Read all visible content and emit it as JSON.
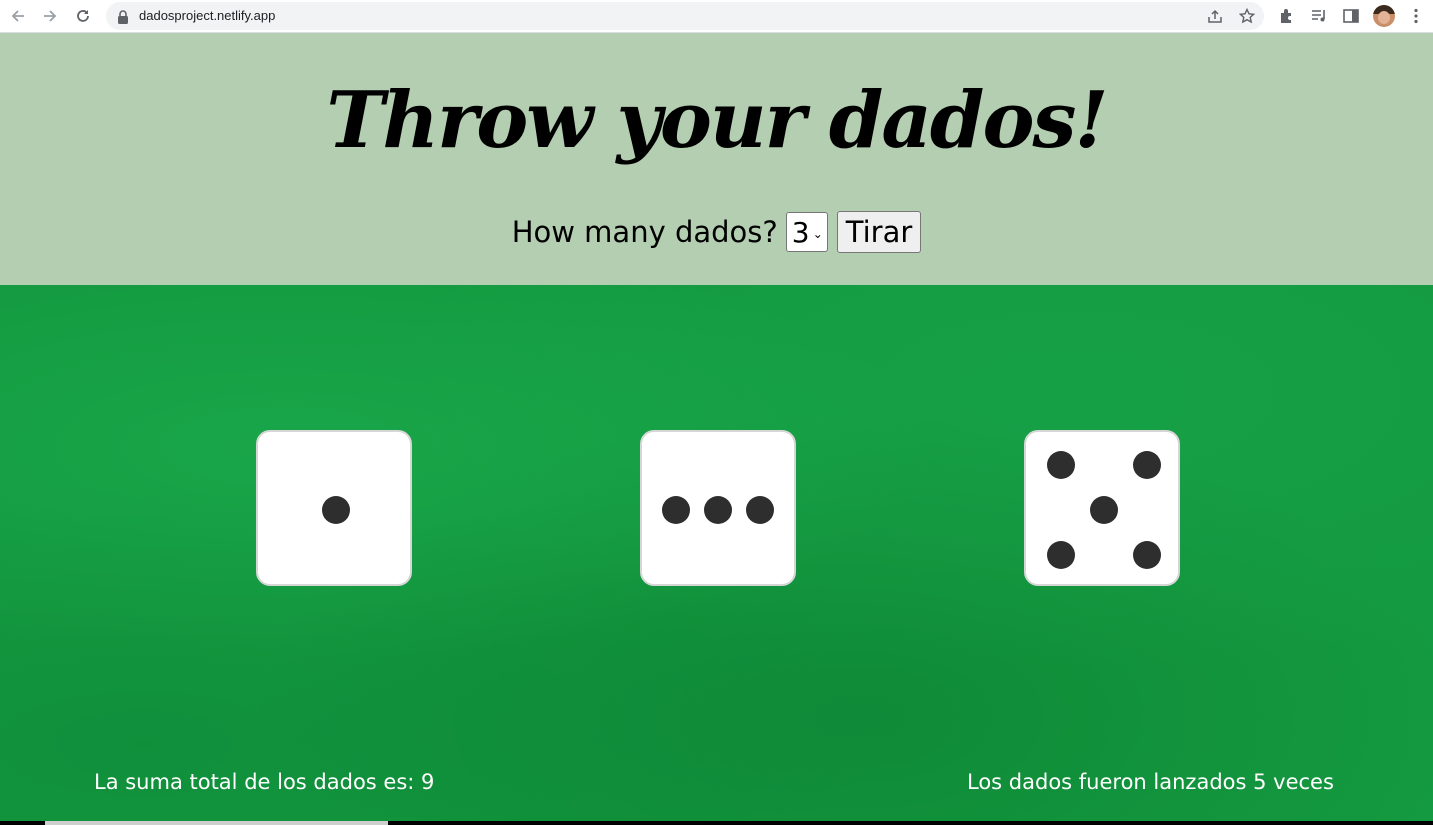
{
  "browser": {
    "url": "dadosproject.netlify.app",
    "icons": [
      "back-icon",
      "forward-icon",
      "reload-icon",
      "lock-icon",
      "share-icon",
      "star-icon",
      "extensions-icon",
      "media-icon",
      "sidepanel-icon",
      "avatar",
      "menu-icon"
    ]
  },
  "header": {
    "title": "Throw your dados!",
    "prompt_label": "How many dados?",
    "dice_count_value": "3",
    "roll_button_label": "Tirar",
    "background_color": "#b4ceb1"
  },
  "table": {
    "background_color": "#149a40",
    "dice": [
      {
        "value": 1
      },
      {
        "value": 3
      },
      {
        "value": 5
      }
    ],
    "sum_text": "La suma total de los dados es: 9",
    "throws_text": "Los dados fueron lanzados 5 veces"
  }
}
